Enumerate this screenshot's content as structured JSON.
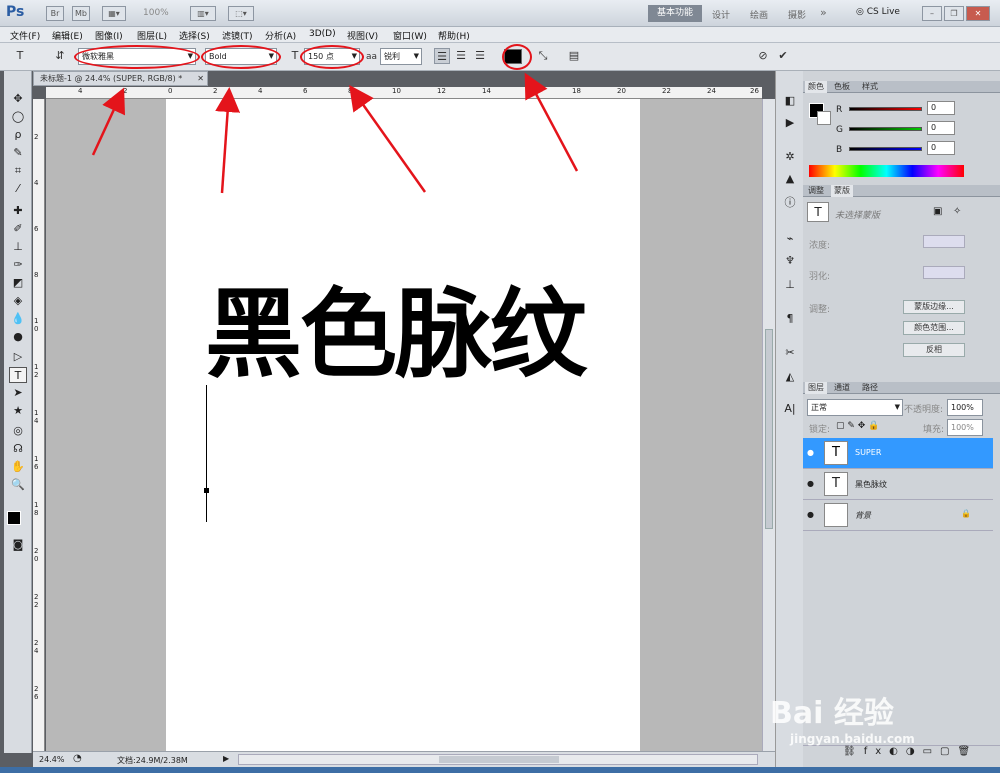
{
  "app": {
    "logo": "Ps",
    "zoom": "100%",
    "cs_live": "CS Live"
  },
  "workspaces": [
    "基本功能",
    "设计",
    "绘画",
    "摄影"
  ],
  "menu": [
    "文件(F)",
    "编辑(E)",
    "图像(I)",
    "图层(L)",
    "选择(S)",
    "滤镜(T)",
    "分析(A)",
    "3D(D)",
    "视图(V)",
    "窗口(W)",
    "帮助(H)"
  ],
  "options": {
    "font_family": "微软雅黑",
    "font_style": "Bold",
    "font_size": "150 点",
    "aa_label": "aa",
    "antialias": "锐利",
    "color": "#000000"
  },
  "document": {
    "tab": "未标题-1 @ 24.4% (SUPER, RGB/8) *",
    "text": "黑色脉纹"
  },
  "ruler_h": [
    "4",
    "2",
    "0",
    "2",
    "4",
    "6",
    "8",
    "10",
    "12",
    "14",
    "16",
    "18",
    "20",
    "22",
    "24",
    "26"
  ],
  "ruler_v": [
    "2",
    "4",
    "6",
    "8",
    "1 0",
    "1 2",
    "1 4",
    "1 6",
    "1 8",
    "2 0",
    "2 2",
    "2 4",
    "2 6"
  ],
  "status": {
    "zoom": "24.4%",
    "doc": "文档:24.9M/2.38M"
  },
  "color_panel": {
    "tabs": [
      "颜色",
      "色板",
      "样式"
    ],
    "r_label": "R",
    "g_label": "G",
    "b_label": "B",
    "r": "0",
    "g": "0",
    "b": "0"
  },
  "mask_panel": {
    "tabs": [
      "调整",
      "蒙版"
    ],
    "hint": "未选择蒙版",
    "density": "浓度:",
    "feather": "羽化:",
    "adjust": "调整:",
    "buttons": [
      "蒙版边缘...",
      "颜色范围...",
      "反相"
    ]
  },
  "layers_panel": {
    "tabs": [
      "图层",
      "通道",
      "路径"
    ],
    "blend": "正常",
    "opacity_label": "不透明度:",
    "opacity": "100%",
    "lock_label": "锁定:",
    "fill_label": "填充:",
    "fill": "100%",
    "layers": [
      {
        "name": "SUPER",
        "selected": true,
        "thumb": "T"
      },
      {
        "name": "黑色脉纹",
        "selected": false,
        "thumb": "T"
      },
      {
        "name": "背景",
        "selected": false,
        "thumb": ""
      }
    ]
  },
  "watermark": {
    "text": "Bai 经验",
    "sub": "jingyan.baidu.com"
  }
}
